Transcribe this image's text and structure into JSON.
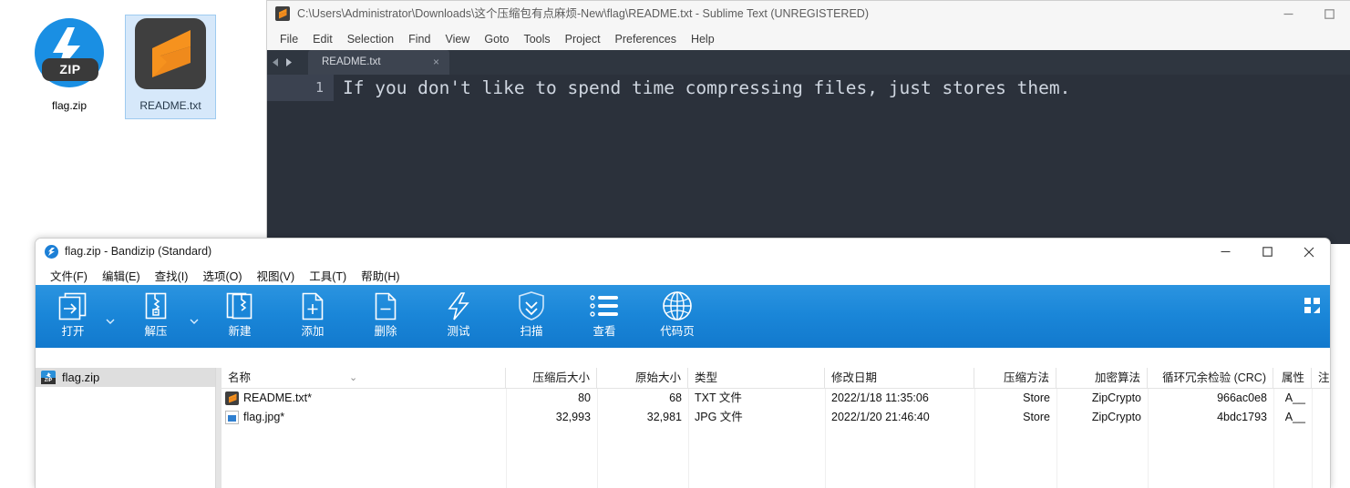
{
  "desktop": {
    "icons": [
      {
        "name": "flag.zip",
        "type": "zip-archive",
        "badge": "ZIP",
        "selected": false
      },
      {
        "name": "README.txt",
        "type": "sublime-text-file",
        "selected": true
      }
    ]
  },
  "sublime": {
    "title": "C:\\Users\\Administrator\\Downloads\\这个压缩包有点麻烦-New\\flag\\README.txt - Sublime Text (UNREGISTERED)",
    "window_controls": {
      "minimize": "—",
      "maximize": "□"
    },
    "menu": [
      "File",
      "Edit",
      "Selection",
      "Find",
      "View",
      "Goto",
      "Tools",
      "Project",
      "Preferences",
      "Help"
    ],
    "tabs": [
      {
        "label": "README.txt",
        "close": "×",
        "active": true
      }
    ],
    "editor": {
      "line_number": "1",
      "line_text": "If you don't like to spend time compressing files, just stores them.",
      "background": "#2b313b",
      "text_color": "#cfd6e0"
    }
  },
  "bandizip": {
    "title": "flag.zip - Bandizip (Standard)",
    "window_controls": {
      "minimize": "—",
      "maximize": "□",
      "close": "✕"
    },
    "menu": [
      "文件(F)",
      "编辑(E)",
      "查找(I)",
      "选项(O)",
      "视图(V)",
      "工具(T)",
      "帮助(H)"
    ],
    "toolbar": {
      "accent": "#1a86d8",
      "items": [
        {
          "label": "打开",
          "icon": "open-archive-icon",
          "caret": true
        },
        {
          "label": "解压",
          "icon": "extract-icon",
          "caret": true
        },
        {
          "label": "新建",
          "icon": "new-archive-icon",
          "caret": false
        },
        {
          "label": "添加",
          "icon": "add-file-icon",
          "caret": false
        },
        {
          "label": "删除",
          "icon": "delete-file-icon",
          "caret": false
        },
        {
          "label": "测试",
          "icon": "test-bolt-icon",
          "caret": false
        },
        {
          "label": "扫描",
          "icon": "scan-shield-icon",
          "caret": false
        },
        {
          "label": "查看",
          "icon": "view-list-icon",
          "caret": false
        },
        {
          "label": "代码页",
          "icon": "codepage-globe-icon",
          "caret": false
        }
      ],
      "layout_toggle": "grid-layout-icon"
    },
    "tree": {
      "root_label": "flag.zip",
      "selected": true
    },
    "list": {
      "columns": [
        {
          "label": "名称",
          "align": "left"
        },
        {
          "label": "压缩后大小",
          "align": "right"
        },
        {
          "label": "原始大小",
          "align": "right"
        },
        {
          "label": "类型",
          "align": "left"
        },
        {
          "label": "修改日期",
          "align": "left"
        },
        {
          "label": "压缩方法",
          "align": "right"
        },
        {
          "label": "加密算法",
          "align": "right"
        },
        {
          "label": "循环冗余检验 (CRC)",
          "align": "right"
        },
        {
          "label": "属性",
          "align": "right"
        },
        {
          "label": "注释",
          "align": "left"
        }
      ],
      "rows": [
        {
          "name": "README.txt*",
          "icon": "sublime-text-file-icon",
          "packed_size": "80",
          "original_size": "68",
          "type": "TXT 文件",
          "modified": "2022/1/18 11:35:06",
          "method": "Store",
          "encryption": "ZipCrypto",
          "crc": "966ac0e8",
          "attributes": "A__",
          "comment": ""
        },
        {
          "name": "flag.jpg*",
          "icon": "image-file-icon",
          "packed_size": "32,993",
          "original_size": "32,981",
          "type": "JPG 文件",
          "modified": "2022/1/20 21:46:40",
          "method": "Store",
          "encryption": "ZipCrypto",
          "crc": "4bdc1793",
          "attributes": "A__",
          "comment": ""
        }
      ]
    }
  }
}
